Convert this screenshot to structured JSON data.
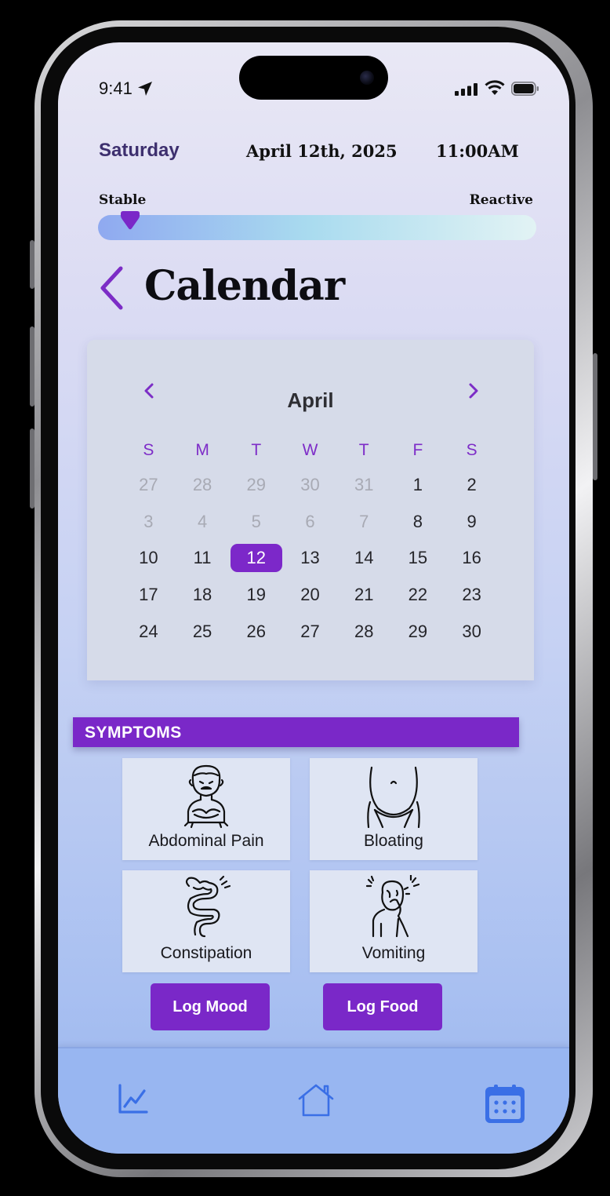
{
  "status_bar": {
    "time": "9:41"
  },
  "header": {
    "day": "Saturday",
    "date": "April 12th, 2025",
    "time": "11:00AM"
  },
  "mood_scale": {
    "left_label": "Stable",
    "right_label": "Reactive",
    "value": 0.05
  },
  "page_title": "Calendar",
  "calendar": {
    "month": "April",
    "weekdays": [
      "S",
      "M",
      "T",
      "W",
      "T",
      "F",
      "S"
    ],
    "weeks": [
      [
        "27",
        "28",
        "29",
        "30",
        "31",
        "1",
        "2"
      ],
      [
        "3",
        "4",
        "5",
        "6",
        "7",
        "8",
        "9"
      ],
      [
        "10",
        "11",
        "12",
        "13",
        "14",
        "15",
        "16"
      ],
      [
        "17",
        "18",
        "19",
        "20",
        "21",
        "22",
        "23"
      ],
      [
        "24",
        "25",
        "26",
        "27",
        "28",
        "29",
        "30"
      ]
    ],
    "selected_day": "12"
  },
  "symptoms": {
    "header": "SYMPTOMS",
    "items": [
      {
        "label": "Abdominal Pain",
        "icon": "abdominal-pain-icon"
      },
      {
        "label": "Bloating",
        "icon": "bloating-icon"
      },
      {
        "label": "Constipation",
        "icon": "intestine-icon"
      },
      {
        "label": "Vomiting",
        "icon": "nausea-icon"
      }
    ]
  },
  "actions": {
    "log_mood": "Log Mood",
    "log_food": "Log Food"
  },
  "tabbar": {
    "items": [
      {
        "icon": "chart-icon",
        "active": false
      },
      {
        "icon": "home-icon",
        "active": false
      },
      {
        "icon": "calendar-icon",
        "active": true
      }
    ]
  },
  "colors": {
    "accent": "#7a28c8",
    "day_text": "#3d2f6e",
    "tab_icon": "#3a6fe6",
    "tabbar_bg": "#98b6f1"
  }
}
